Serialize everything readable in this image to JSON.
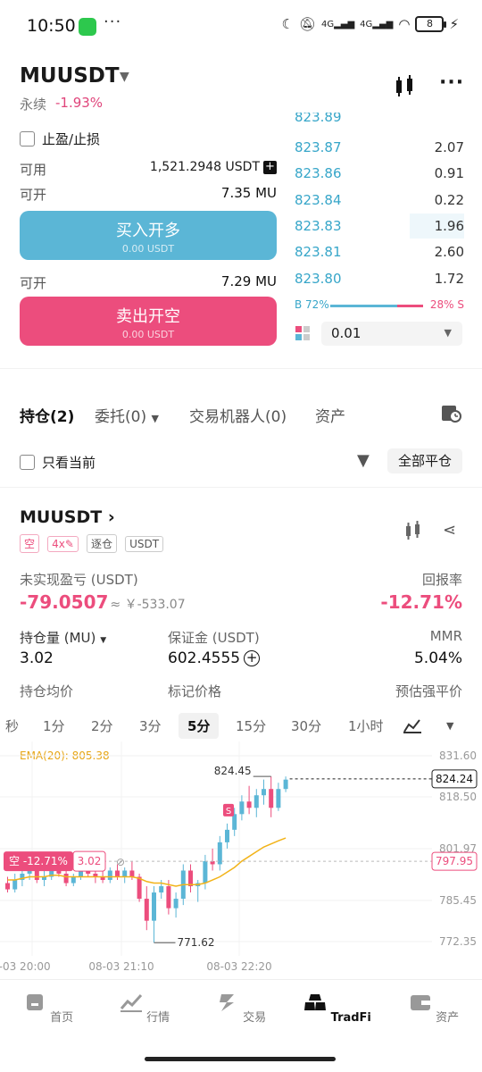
{
  "status": {
    "time": "10:50",
    "dots": "···",
    "net1": "4G",
    "net2": "4G",
    "battery": "8"
  },
  "header": {
    "symbol": "MUUSDT",
    "type": "永续",
    "change": "-1.93%"
  },
  "order_form": {
    "tpsl_label": "止盈/止损",
    "available_label": "可用",
    "available_value": "1,521.2948 USDT",
    "open_label": "可开",
    "open_long_value": "7.35 MU",
    "buy_label": "买入开多",
    "buy_sub": "0.00 USDT",
    "open_short_value": "7.29 MU",
    "sell_label": "卖出开空",
    "sell_sub": "0.00 USDT"
  },
  "order_book": {
    "top_partial": "823.89",
    "rows": [
      {
        "price": "823.87",
        "qty": "2.07",
        "depth": 0.0
      },
      {
        "price": "823.86",
        "qty": "0.91",
        "depth": 0.0
      },
      {
        "price": "823.84",
        "qty": "0.22",
        "depth": 0.0
      },
      {
        "price": "823.83",
        "qty": "1.96",
        "depth": 0.32
      },
      {
        "price": "823.81",
        "qty": "2.60",
        "depth": 0.0
      },
      {
        "price": "823.80",
        "qty": "1.72",
        "depth": 0.0
      }
    ],
    "buy_ratio": "B 72%",
    "sell_ratio": "28% S",
    "buy_fraction": 0.72,
    "precision": "0.01"
  },
  "tabs": [
    {
      "label": "持仓(2)"
    },
    {
      "label": "委托(0)"
    },
    {
      "label": "交易机器人(0)"
    },
    {
      "label": "资产"
    }
  ],
  "filter": {
    "only_current": "只看当前",
    "close_all": "全部平仓"
  },
  "position": {
    "symbol": "MUUSDT",
    "tags": [
      "空",
      "4x",
      "逐仓",
      "USDT"
    ],
    "pnl_label": "未实现盈亏 (USDT)",
    "pnl_value": "-79.0507",
    "pnl_cny": "≈ ￥-533.07",
    "roe_label": "回报率",
    "roe_value": "-12.71%",
    "size_label": "持仓量 (MU)",
    "size_value": "3.02",
    "margin_label": "保证金 (USDT)",
    "margin_value": "602.4555",
    "mmr_label": "MMR",
    "mmr_value": "5.04%",
    "avg_label": "持仓均价",
    "mark_label": "标记价格",
    "liq_label": "预估强平价"
  },
  "timeframes": [
    "秒",
    "1分",
    "2分",
    "3分",
    "5分",
    "15分",
    "30分",
    "1小时"
  ],
  "active_timeframe": "5分",
  "chart_data": {
    "type": "candlestick",
    "indicator": "EMA(20): 805.38",
    "y_ticks": [
      "831.60",
      "818.50",
      "801.97",
      "785.45",
      "772.35"
    ],
    "x_ticks": [
      "08-03 20:00",
      "08-03 21:10",
      "08-03 22:20"
    ],
    "last_price": "824.24",
    "position_price": "797.95",
    "high_label": "824.45",
    "low_label": "771.62",
    "position_tag": "空 -12.71%",
    "position_qty": "3.02",
    "marker": "S",
    "candles": [
      [
        791,
        793,
        788,
        789
      ],
      [
        789,
        794,
        788,
        792
      ],
      [
        792,
        795,
        790,
        794
      ],
      [
        794,
        797,
        792,
        795
      ],
      [
        795,
        796,
        791,
        792
      ],
      [
        792,
        795,
        790,
        793
      ],
      [
        793,
        797,
        792,
        796
      ],
      [
        796,
        797,
        793,
        794
      ],
      [
        794,
        795,
        790,
        791
      ],
      [
        791,
        794,
        790,
        793
      ],
      [
        793,
        796,
        792,
        795
      ],
      [
        795,
        797,
        793,
        794
      ],
      [
        794,
        796,
        791,
        793
      ],
      [
        793,
        795,
        791,
        792
      ],
      [
        792,
        796,
        791,
        795
      ],
      [
        795,
        797,
        792,
        793
      ],
      [
        793,
        796,
        791,
        795
      ],
      [
        795,
        798,
        792,
        793
      ],
      [
        793,
        794,
        785,
        786
      ],
      [
        786,
        790,
        776,
        779
      ],
      [
        779,
        790,
        772,
        788
      ],
      [
        788,
        792,
        786,
        790
      ],
      [
        790,
        792,
        781,
        783
      ],
      [
        783,
        788,
        780,
        786
      ],
      [
        786,
        797,
        784,
        795
      ],
      [
        795,
        797,
        788,
        790
      ],
      [
        790,
        792,
        785,
        791
      ],
      [
        791,
        800,
        789,
        798
      ],
      [
        798,
        802,
        795,
        797
      ],
      [
        797,
        806,
        795,
        804
      ],
      [
        804,
        810,
        802,
        808
      ],
      [
        808,
        815,
        806,
        813
      ],
      [
        813,
        819,
        811,
        817
      ],
      [
        817,
        822,
        813,
        815
      ],
      [
        815,
        821,
        812,
        819
      ],
      [
        819,
        824,
        816,
        821
      ],
      [
        821,
        825,
        812,
        815
      ],
      [
        815,
        823,
        814,
        821
      ],
      [
        821,
        825,
        820,
        824
      ]
    ],
    "ema": [
      792,
      792,
      792.5,
      793,
      793,
      793,
      793.5,
      793.5,
      793,
      793,
      793,
      793,
      793,
      793,
      793,
      793,
      793,
      793,
      792.5,
      791.5,
      791,
      791,
      790.5,
      790,
      790.5,
      790.5,
      790.5,
      791,
      792,
      793,
      794.5,
      796,
      798,
      799.5,
      801,
      802.5,
      803.5,
      804.5,
      805.38
    ]
  },
  "nav": [
    {
      "label": "首页"
    },
    {
      "label": "行情"
    },
    {
      "label": "交易"
    },
    {
      "label": "TradFi"
    },
    {
      "label": "资产"
    }
  ],
  "colors": {
    "up": "#5bb6d6",
    "down": "#ec4d7d",
    "ema": "#f2b318"
  }
}
